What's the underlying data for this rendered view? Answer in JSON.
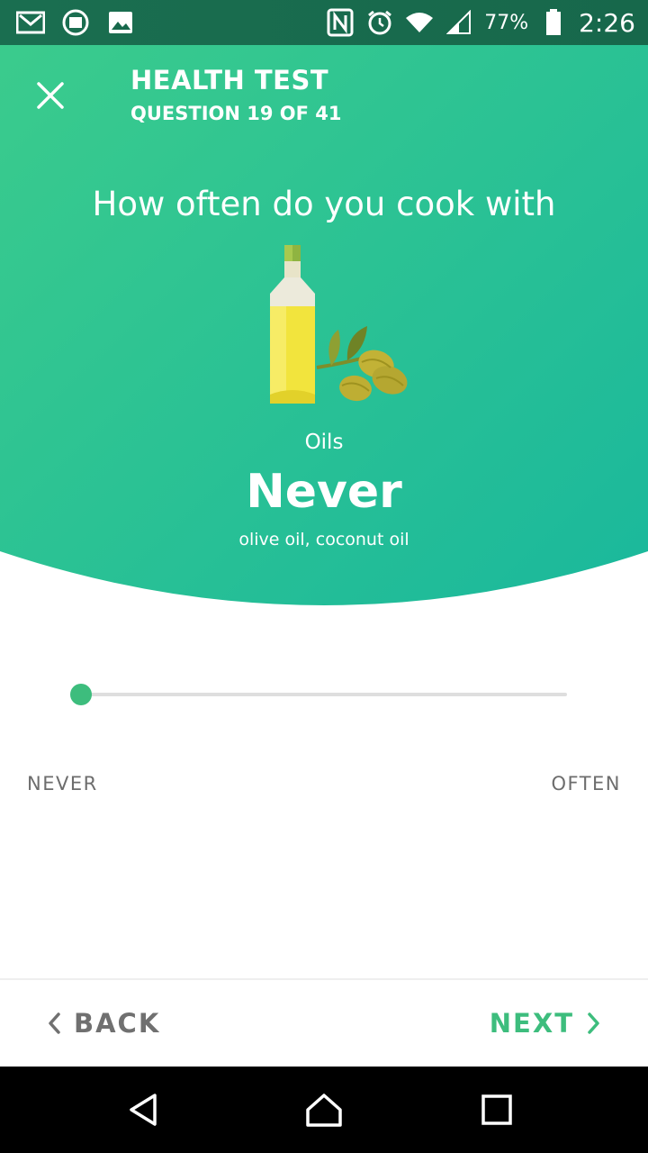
{
  "status_bar": {
    "icons_left": [
      "gmail-icon",
      "sf-app-icon",
      "image-icon"
    ],
    "icons_right": [
      "nfc-icon",
      "alarm-icon",
      "wifi-icon",
      "signal-icon",
      "battery-icon"
    ],
    "battery": "77%",
    "time": "2:26"
  },
  "header": {
    "title": "HEALTH TEST",
    "subtitle": "QUESTION 19 OF 41",
    "close_icon": "close-icon"
  },
  "question": {
    "text": "How often do you cook with",
    "illustration": "olive-oil-bottle-icon",
    "category": "Oils",
    "answer": "Never",
    "examples": "olive oil, coconut oil"
  },
  "slider": {
    "value": 0,
    "min": 0,
    "max": 1,
    "low_label": "NEVER",
    "high_label": "OFTEN"
  },
  "footer": {
    "back_label": "BACK",
    "next_label": "NEXT"
  },
  "colors": {
    "gradient_start": "#3ccc8c",
    "gradient_end": "#1ab89c",
    "accent": "#3dbd7d",
    "muted_text": "#707070"
  }
}
